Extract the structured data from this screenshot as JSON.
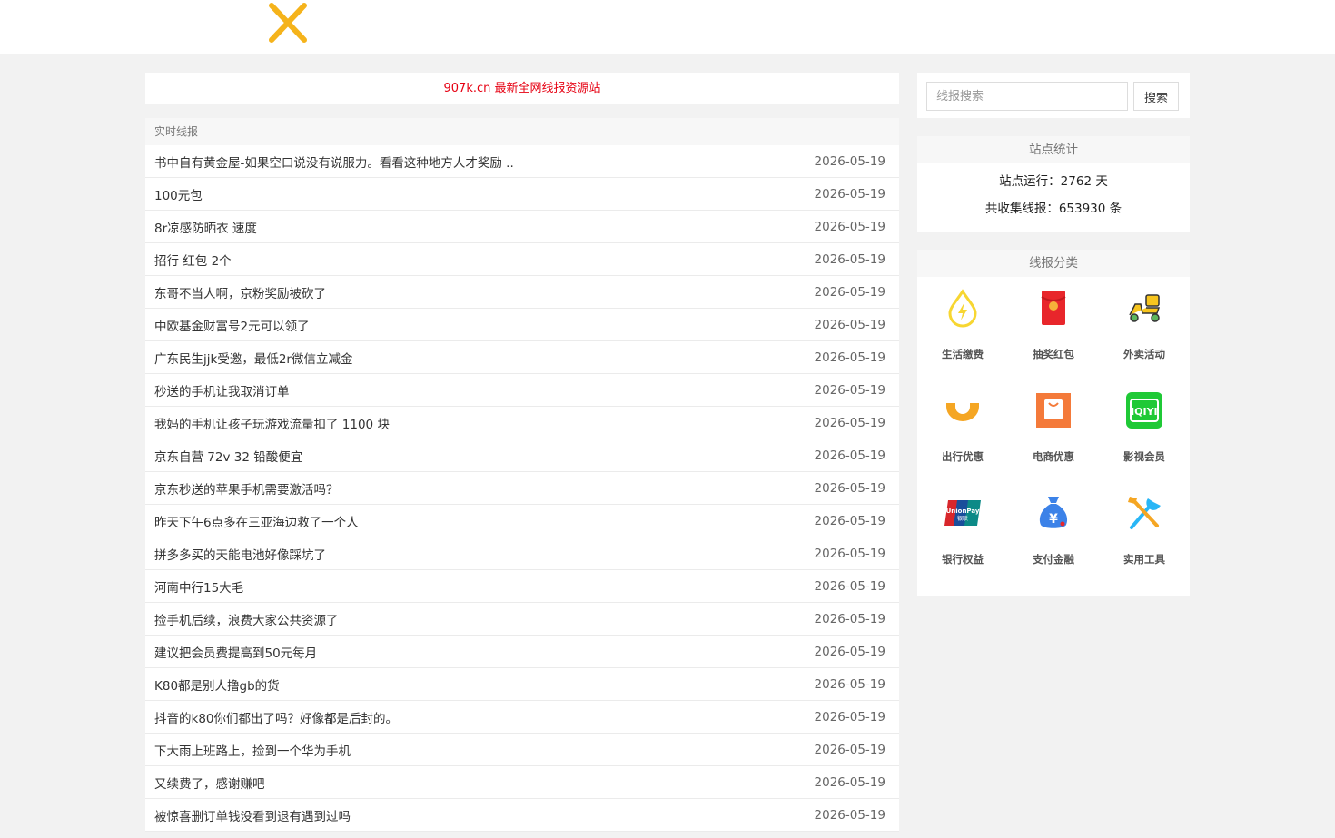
{
  "header": {
    "logo_icon": "close-x-logo-icon",
    "logo_color": "#f5b31b"
  },
  "banner": {
    "text": "907k.cn 最新全网线报资源站",
    "color": "#e60012"
  },
  "list": {
    "heading": "实时线报",
    "items": [
      {
        "title": "书中自有黄金屋-如果空口说没有说服力。看看这种地方人才奖励 ..",
        "date": "2026-05-19"
      },
      {
        "title": "100元包",
        "date": "2026-05-19"
      },
      {
        "title": "8r凉感防晒衣 速度",
        "date": "2026-05-19"
      },
      {
        "title": "招行 红包 2个",
        "date": "2026-05-19"
      },
      {
        "title": "东哥不当人啊，京粉奖励被砍了",
        "date": "2026-05-19"
      },
      {
        "title": "中欧基金财富号2元可以领了",
        "date": "2026-05-19"
      },
      {
        "title": "广东民生jjk受邀，最低2r微信立减金",
        "date": "2026-05-19"
      },
      {
        "title": "秒送的手机让我取消订单",
        "date": "2026-05-19"
      },
      {
        "title": "我妈的手机让孩子玩游戏流量扣了 1100 块",
        "date": "2026-05-19"
      },
      {
        "title": "京东自营 72v 32 铅酸便宜",
        "date": "2026-05-19"
      },
      {
        "title": "京东秒送的苹果手机需要激活吗？",
        "date": "2026-05-19"
      },
      {
        "title": "昨天下午6点多在三亚海边救了一个人",
        "date": "2026-05-19"
      },
      {
        "title": "拼多多买的天能电池好像踩坑了",
        "date": "2026-05-19"
      },
      {
        "title": "河南中行15大毛",
        "date": "2026-05-19"
      },
      {
        "title": "捡手机后续，浪费大家公共资源了",
        "date": "2026-05-19"
      },
      {
        "title": "建议把会员费提高到50元每月",
        "date": "2026-05-19"
      },
      {
        "title": "K80都是别人撸gb的货",
        "date": "2026-05-19"
      },
      {
        "title": "抖音的k80你们都出了吗？好像都是后封的。",
        "date": "2026-05-19"
      },
      {
        "title": "下大雨上班路上，捡到一个华为手机",
        "date": "2026-05-19"
      },
      {
        "title": "又续费了，感谢赚吧",
        "date": "2026-05-19"
      },
      {
        "title": "被惊喜删订单钱没看到退有遇到过吗",
        "date": "2026-05-19"
      }
    ]
  },
  "search": {
    "placeholder": "线报搜索",
    "value": "",
    "button_label": "搜索"
  },
  "stats": {
    "heading": "站点统计",
    "running": "站点运行：2762 天",
    "collected": "共收集线报：653930 条"
  },
  "categories": {
    "heading": "线报分类",
    "items": [
      {
        "label": "生活缴费",
        "icon": "utility-drop-icon",
        "color": "#f7d631"
      },
      {
        "label": "抽奖红包",
        "icon": "red-envelope-icon",
        "color": "#e8262b"
      },
      {
        "label": "外卖活动",
        "icon": "delivery-scooter-icon",
        "color": "#f7c51e"
      },
      {
        "label": "出行优惠",
        "icon": "didi-ride-icon",
        "color": "#f5a623"
      },
      {
        "label": "电商优惠",
        "icon": "shopping-bag-icon",
        "color": "#f47a3a"
      },
      {
        "label": "影视会员",
        "icon": "iqiyi-icon",
        "color": "#1fc936"
      },
      {
        "label": "银行权益",
        "icon": "unionpay-icon",
        "color": "#d8262b"
      },
      {
        "label": "支付金融",
        "icon": "money-bag-icon",
        "color": "#3c82e8"
      },
      {
        "label": "实用工具",
        "icon": "tools-icon",
        "color": "#29b6f6"
      }
    ]
  }
}
